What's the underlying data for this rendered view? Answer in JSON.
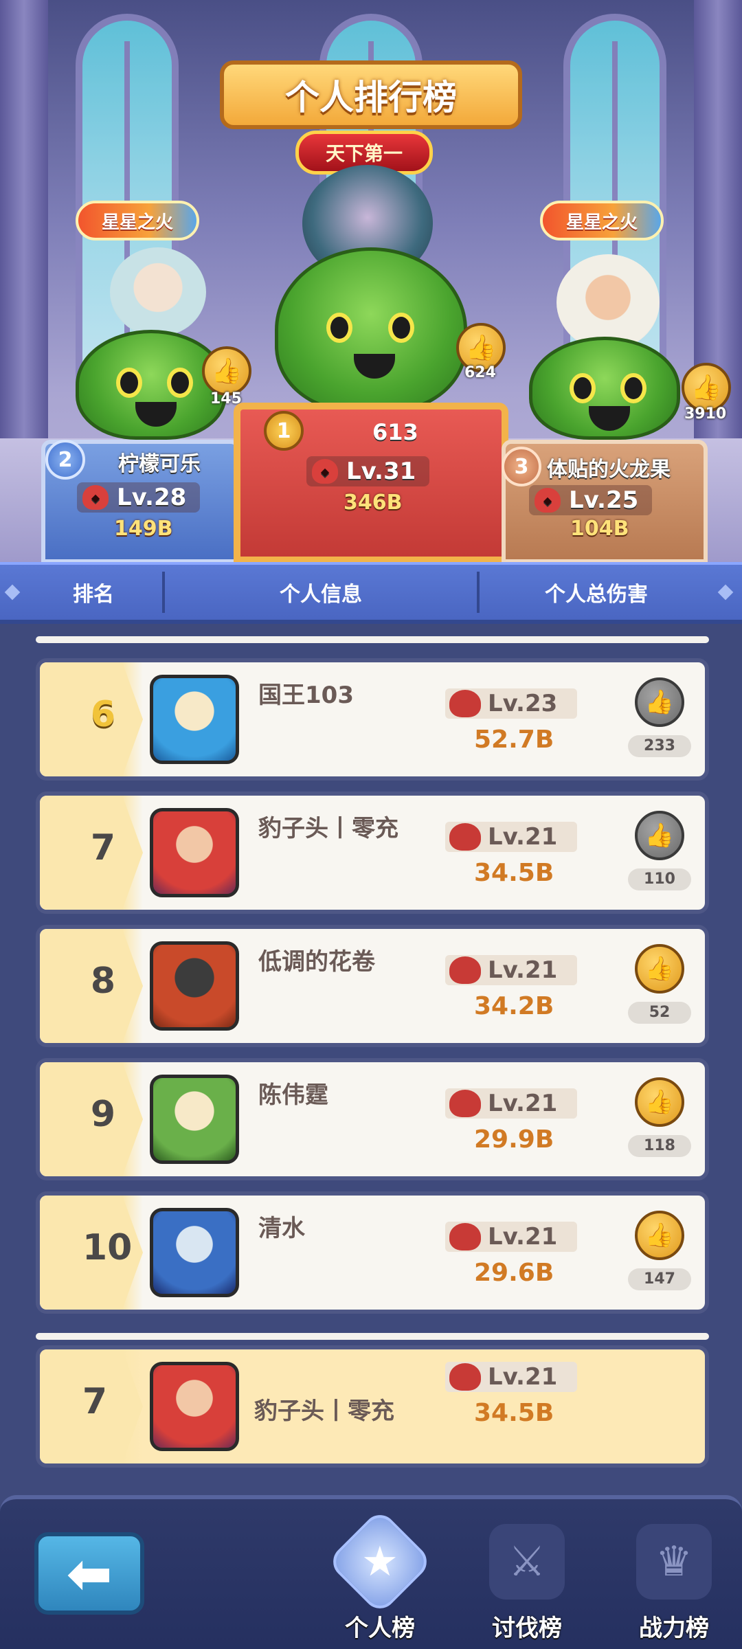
{
  "title": "个人排行榜",
  "podium": {
    "first": {
      "badge": "天下第一",
      "rank": "1",
      "score": "613",
      "level": "Lv.31",
      "damage": "346B",
      "likes": "624"
    },
    "second": {
      "badge": "星星之火",
      "rank": "2",
      "name": "柠檬可乐",
      "level": "Lv.28",
      "damage": "149B",
      "likes": "145"
    },
    "third": {
      "badge": "星星之火",
      "rank": "3",
      "name": "体贴的火龙果",
      "level": "Lv.25",
      "damage": "104B",
      "likes": "3910"
    }
  },
  "columns": {
    "rank": "排名",
    "info": "个人信息",
    "damage": "个人总伤害"
  },
  "rows": [
    {
      "rank": "6",
      "name": "国王103",
      "level": "Lv.23",
      "damage": "52.7B",
      "likes": "233",
      "liked": false
    },
    {
      "rank": "7",
      "name": "豹子头丨零充",
      "level": "Lv.21",
      "damage": "34.5B",
      "likes": "110",
      "liked": false
    },
    {
      "rank": "8",
      "name": "低调的花卷",
      "level": "Lv.21",
      "damage": "34.2B",
      "likes": "52",
      "liked": true
    },
    {
      "rank": "9",
      "name": "陈伟霆",
      "level": "Lv.21",
      "damage": "29.9B",
      "likes": "118",
      "liked": true
    },
    {
      "rank": "10",
      "name": "清水",
      "level": "Lv.21",
      "damage": "29.6B",
      "likes": "147",
      "liked": true
    }
  ],
  "self": {
    "rank": "7",
    "name": "豹子头丨零充",
    "level": "Lv.21",
    "damage": "34.5B"
  },
  "nav": {
    "personal": "个人榜",
    "crusade": "讨伐榜",
    "power": "战力榜"
  },
  "icons": {
    "back": "arrow-left-icon",
    "like": "thumbs-up-icon",
    "level": "demon-skull-icon",
    "personal": "star-medal-icon",
    "crusade": "crossed-swords-icon",
    "power": "shield-crown-icon"
  }
}
